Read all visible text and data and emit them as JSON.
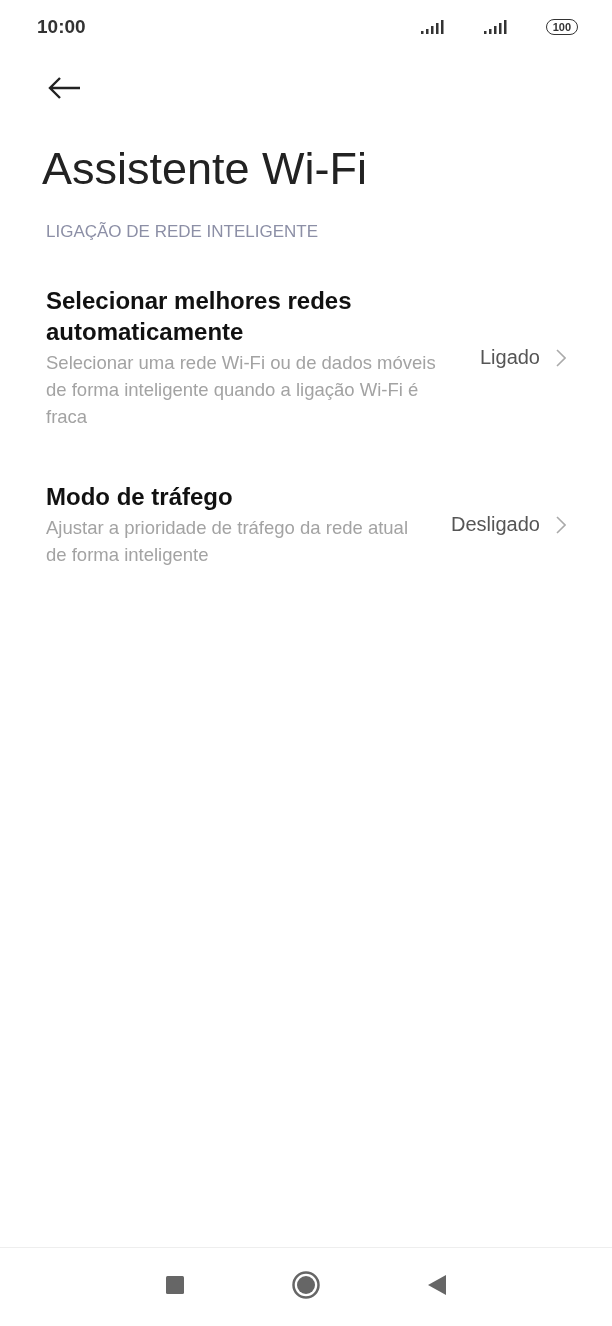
{
  "status_bar": {
    "time": "10:00",
    "battery": "100"
  },
  "title": "Assistente Wi-Fi",
  "section": "LIGAÇÃO DE REDE INTELIGENTE",
  "settings": [
    {
      "title": "Selecionar melhores redes automaticamente",
      "description": "Selecionar uma rede Wi-Fi ou de dados móveis de forma inteligente quando a ligação Wi-Fi é fraca",
      "value": "Ligado"
    },
    {
      "title": "Modo de tráfego",
      "description": "Ajustar a prioridade de tráfego da rede atual de forma inteligente",
      "value": "Desligado"
    }
  ]
}
